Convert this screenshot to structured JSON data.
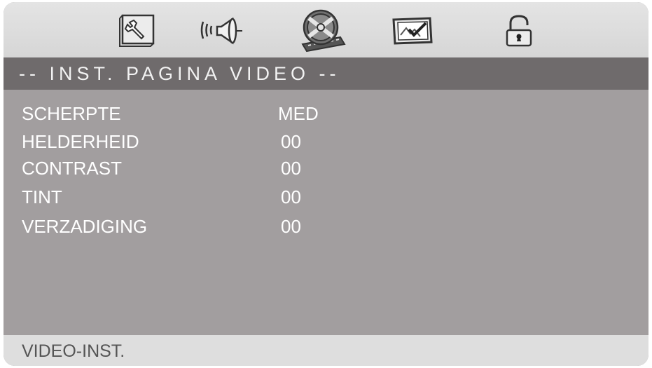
{
  "tabs": [
    {
      "icon": "wrench-icon",
      "name": "general-setup"
    },
    {
      "icon": "speaker-icon",
      "name": "audio-setup"
    },
    {
      "icon": "film-reel-icon",
      "name": "video-setup",
      "active": true
    },
    {
      "icon": "checked-picture-icon",
      "name": "preference-setup"
    },
    {
      "icon": "padlock-icon",
      "name": "password-setup"
    }
  ],
  "page_title": "-- INST. PAGINA VIDEO --",
  "settings": [
    {
      "label": "SCHERPTE",
      "value": "MED"
    },
    {
      "label": "HELDERHEID",
      "value": "00"
    },
    {
      "label": "CONTRAST",
      "value": "00"
    },
    {
      "label": "TINT",
      "value": "00"
    },
    {
      "label": "VERZADIGING",
      "value": "00"
    }
  ],
  "status_text": "VIDEO-INST.",
  "colors": {
    "tab_bar": "#d9d9d9",
    "title_bar": "#6f6b6c",
    "body": "#a29e9f",
    "status_bar": "#dedede",
    "text": "#ffffff"
  }
}
